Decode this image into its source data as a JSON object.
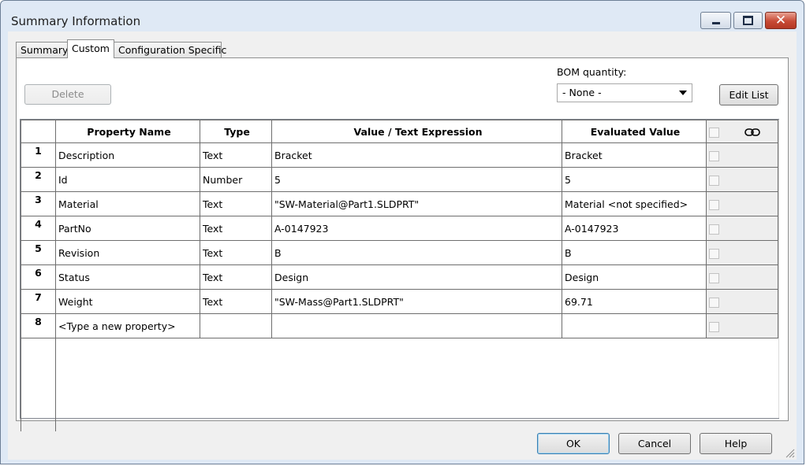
{
  "window": {
    "title": "Summary Information",
    "controls": {
      "minimize": "minimize-icon",
      "maximize": "maximize-icon",
      "close": "close-icon"
    }
  },
  "tabs": [
    {
      "label": "Summary",
      "active": false
    },
    {
      "label": "Custom",
      "active": true
    },
    {
      "label": "Configuration Specific",
      "active": false
    }
  ],
  "toolbar": {
    "delete_label": "Delete",
    "bom_label": "BOM quantity:",
    "bom_value": "- None -",
    "edit_list_label": "Edit List"
  },
  "table": {
    "columns": [
      "Property Name",
      "Type",
      "Value / Text Expression",
      "Evaluated Value"
    ],
    "rows": [
      {
        "num": "1",
        "name": "Description",
        "type": "Text",
        "value": "Bracket",
        "evaluated": "Bracket"
      },
      {
        "num": "2",
        "name": "Id",
        "type": "Number",
        "value": "5",
        "evaluated": "5"
      },
      {
        "num": "3",
        "name": "Material",
        "type": "Text",
        "value": "\"SW-Material@Part1.SLDPRT\"",
        "evaluated": "Material <not specified>"
      },
      {
        "num": "4",
        "name": "PartNo",
        "type": "Text",
        "value": "A-0147923",
        "evaluated": "A-0147923"
      },
      {
        "num": "5",
        "name": "Revision",
        "type": "Text",
        "value": "B",
        "evaluated": "B"
      },
      {
        "num": "6",
        "name": "Status",
        "type": "Text",
        "value": "Design",
        "evaluated": "Design"
      },
      {
        "num": "7",
        "name": "Weight",
        "type": "Text",
        "value": "\"SW-Mass@Part1.SLDPRT\"",
        "evaluated": "69.71"
      },
      {
        "num": "8",
        "name": "<Type a new property>",
        "type": "",
        "value": "",
        "evaluated": ""
      }
    ]
  },
  "footer": {
    "ok_label": "OK",
    "cancel_label": "Cancel",
    "help_label": "Help"
  },
  "colors": {
    "close_button": "#c74a35",
    "frame": "#dfe9f5",
    "client": "#f0f0f0"
  }
}
